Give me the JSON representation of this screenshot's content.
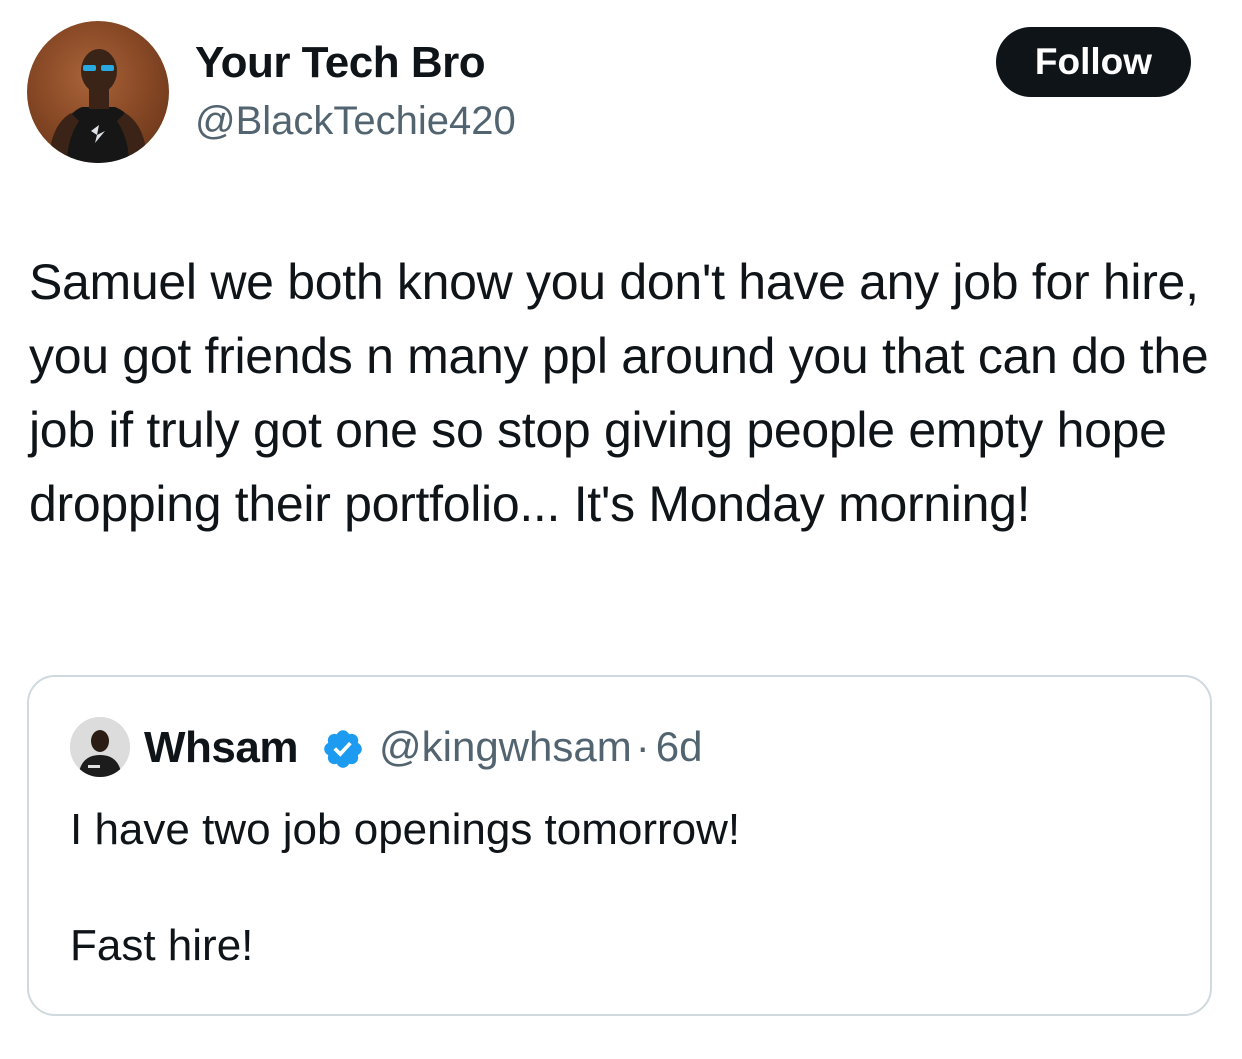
{
  "tweet": {
    "author": {
      "name": "Your Tech Bro",
      "handle": "@BlackTechie420"
    },
    "follow_label": "Follow",
    "text": "Samuel we both know you don't have any job for hire, you got friends n many ppl around you that can do the job if truly got one so stop giving people empty hope dropping their portfolio... It's Monday morning!"
  },
  "quoted": {
    "author": {
      "name": "Whsam",
      "handle": "@kingwhsam",
      "separator": "·",
      "time": "6d",
      "verified": true
    },
    "text": "I have two job openings tomorrow!\n\nFast hire!"
  },
  "colors": {
    "text": "#0f1419",
    "secondary": "#536471",
    "border": "#cfd9de",
    "verified": "#1d9bf0",
    "button_bg": "#0f1419"
  }
}
